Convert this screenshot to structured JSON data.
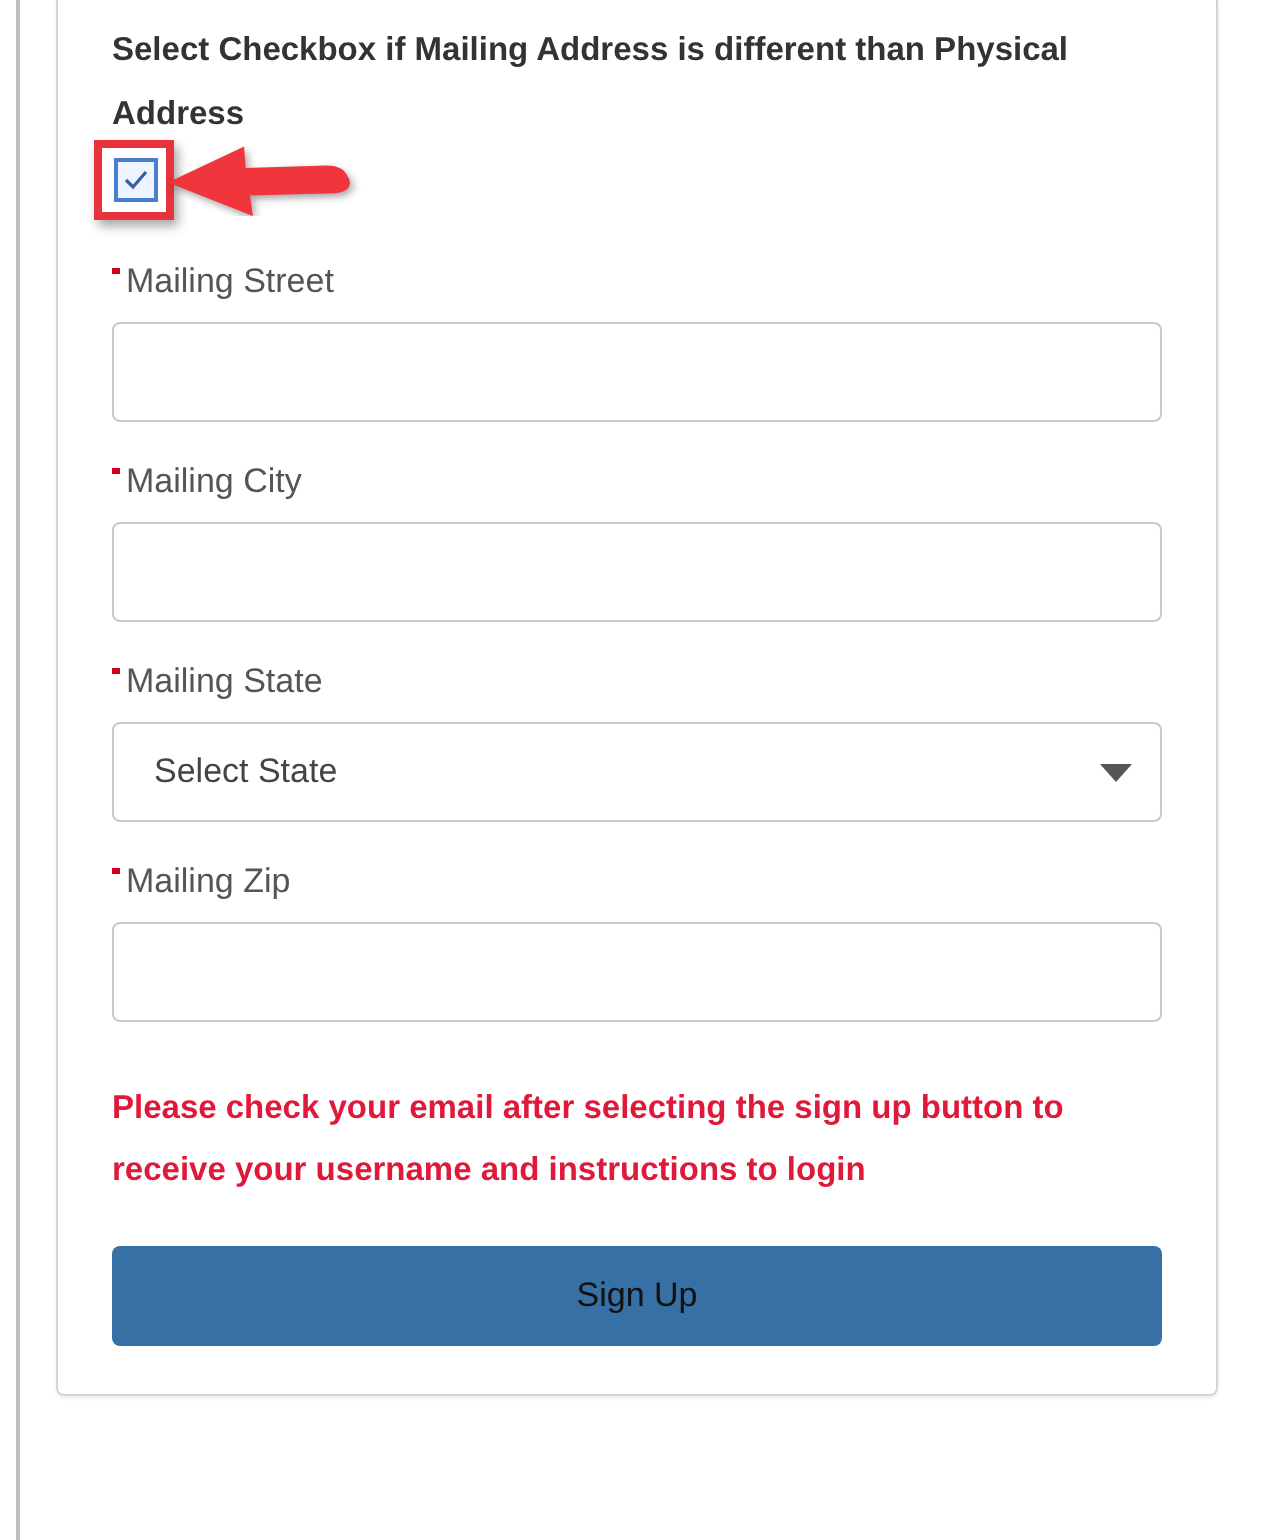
{
  "heading": "Select Checkbox if Mailing Address is different than Physical Address",
  "checkbox": {
    "checked": true
  },
  "fields": [
    {
      "kind": "text",
      "label": "Mailing Street",
      "required": true
    },
    {
      "kind": "text",
      "label": "Mailing City",
      "required": true
    },
    {
      "kind": "select",
      "label": "Mailing State",
      "required": true,
      "value": "Select State"
    },
    {
      "kind": "text",
      "label": "Mailing Zip",
      "required": true
    }
  ],
  "notice": "Please check your email after selecting the sign up button to receive your username and instructions to login",
  "button": "Sign Up"
}
